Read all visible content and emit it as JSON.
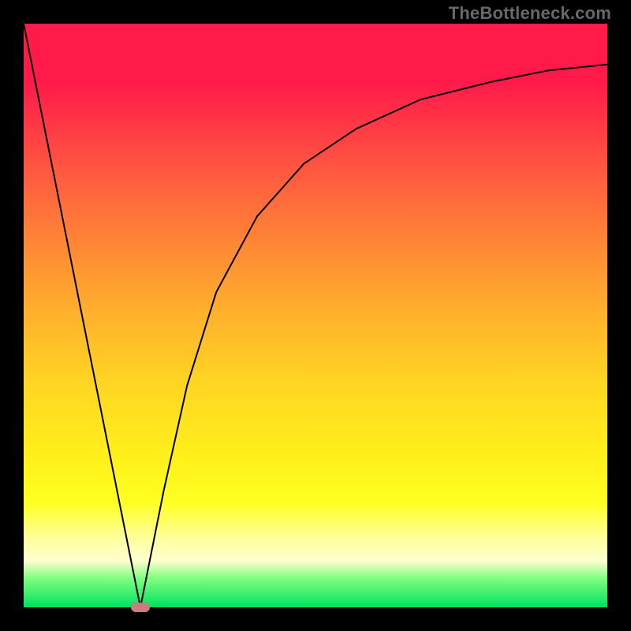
{
  "watermark": "TheBottleneck.com",
  "chart_data": {
    "type": "line",
    "title": "",
    "xlabel": "",
    "ylabel": "",
    "xlim": [
      0,
      1
    ],
    "ylim": [
      0,
      1
    ],
    "series": [
      {
        "name": "curve",
        "x": [
          0.0,
          0.05,
          0.1,
          0.15,
          0.17,
          0.19,
          0.2,
          0.21,
          0.24,
          0.28,
          0.33,
          0.4,
          0.48,
          0.57,
          0.68,
          0.8,
          0.9,
          1.0
        ],
        "y": [
          1.0,
          0.75,
          0.5,
          0.25,
          0.15,
          0.05,
          0.0,
          0.05,
          0.2,
          0.38,
          0.54,
          0.67,
          0.76,
          0.82,
          0.87,
          0.9,
          0.92,
          0.93
        ]
      }
    ],
    "annotations": [
      {
        "name": "minimum-marker",
        "x": 0.2,
        "y": 0.0,
        "color": "#cf7b7e"
      }
    ],
    "background_gradient": {
      "type": "vertical",
      "stops": [
        {
          "pos": 0.0,
          "color": "#ff1a4a"
        },
        {
          "pos": 0.5,
          "color": "#ffb22c"
        },
        {
          "pos": 0.8,
          "color": "#ffff22"
        },
        {
          "pos": 1.0,
          "color": "#00e060"
        }
      ]
    }
  }
}
